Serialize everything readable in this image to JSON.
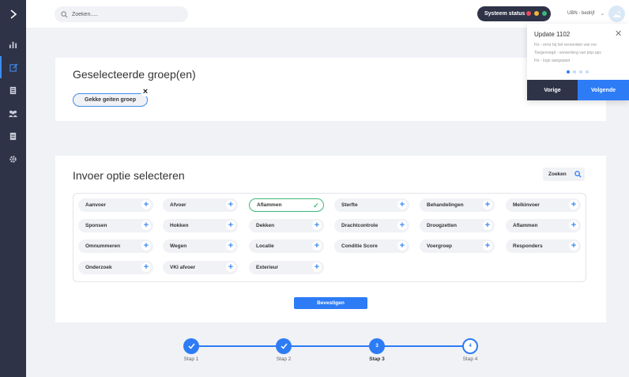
{
  "topbar": {
    "search_placeholder": "Zoeken.....",
    "status_label": "Systeem status",
    "status_colors": [
      "#e84a5f",
      "#f5b335",
      "#3cb878"
    ],
    "company": "UBN - bedrijf"
  },
  "sidebar": {
    "items": [
      "chart-icon",
      "edit-icon",
      "document-icon",
      "users-icon",
      "list-icon",
      "gear-icon"
    ]
  },
  "groups": {
    "title": "Geselecteerde groep(en)",
    "selected": "Gekke geiten groep"
  },
  "options": {
    "title": "Invoer optie selecteren",
    "search_label": "Zoeken",
    "items": [
      "Aanvoer",
      "Afvoer",
      "Aflammen",
      "Sterfte",
      "Behandelingen",
      "Melkinvoer",
      "Sponsen",
      "Hokken",
      "Dekken",
      "Drachtcontrole",
      "Droogzetten",
      "Aflammen",
      "Omnummeren",
      "Wegen",
      "Locatie",
      "Conditie Score",
      "Voergroep",
      "Responders",
      "Onderzoek",
      "VKI afvoer",
      "Exterieur"
    ],
    "selected_index": 2,
    "confirm_label": "Bevestigen"
  },
  "stepper": {
    "steps": [
      "Stap 1",
      "Stap 2",
      "Stap 3",
      "Stap 4"
    ],
    "numbers": [
      "3",
      "4"
    ],
    "current": 3
  },
  "popup": {
    "title": "Update 1102",
    "lines": [
      "Fix - error bij het verzenden van rvo",
      "Toegevoegd - verwerking van pop-ups",
      "Fix - logo aangepast"
    ],
    "prev_label": "Vorige",
    "next_label": "Volgende"
  }
}
